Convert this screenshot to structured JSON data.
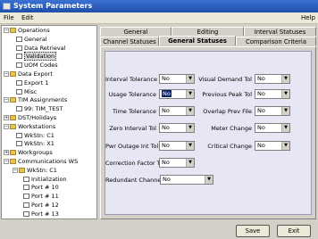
{
  "window": {
    "title": "System Parameters"
  },
  "menu": {
    "file": "File",
    "edit": "Edit",
    "help": "Help"
  },
  "tree": [
    {
      "label": "Operations",
      "type": "folder",
      "expander": "−"
    },
    {
      "label": "General",
      "type": "doc"
    },
    {
      "label": "Data Retrieval",
      "type": "doc"
    },
    {
      "label": "Validation",
      "type": "doc",
      "selected": true
    },
    {
      "label": "UOM Codes",
      "type": "doc"
    },
    {
      "label": "Data Export",
      "type": "folder",
      "expander": "−"
    },
    {
      "label": "Export 1",
      "type": "doc"
    },
    {
      "label": "Misc",
      "type": "doc"
    },
    {
      "label": "TIM Assignments",
      "type": "folder",
      "expander": "−"
    },
    {
      "label": "99: TIM_TEST",
      "type": "doc"
    },
    {
      "label": "DST/Holidays",
      "type": "folder",
      "expander": "+"
    },
    {
      "label": "Workstations",
      "type": "folder",
      "expander": "−"
    },
    {
      "label": "WkStn: C1",
      "type": "doc"
    },
    {
      "label": "WkStn: X1",
      "type": "doc"
    },
    {
      "label": "Workgroups",
      "type": "folder",
      "expander": "+"
    },
    {
      "label": "Communications WS",
      "type": "folder",
      "expander": "−"
    },
    {
      "label": "WkStn: C1",
      "type": "folder",
      "expander": "−"
    },
    {
      "label": "Initialization",
      "type": "doc"
    },
    {
      "label": "Port # 10",
      "type": "doc"
    },
    {
      "label": "Port # 11",
      "type": "doc"
    },
    {
      "label": "Port # 12",
      "type": "doc"
    },
    {
      "label": "Port # 13",
      "type": "doc"
    }
  ],
  "tabs_row1": [
    "General",
    "Editing",
    "Interval Statuses"
  ],
  "tabs_row2": [
    "Channel Statuses",
    "General Statuses",
    "Comparison Criteria"
  ],
  "active_tab": "General Statuses",
  "fields_left": [
    {
      "label": "Interval Tolerance",
      "value": "No"
    },
    {
      "label": "Usage Tolerance",
      "value": "No",
      "highlight": true
    },
    {
      "label": "Time Tolerance",
      "value": "No"
    },
    {
      "label": "Zero Interval Tol",
      "value": "No"
    },
    {
      "label": "Pwr Outage Int Tol",
      "value": "No"
    },
    {
      "label": "Correction Factor Tol",
      "value": "No"
    },
    {
      "label": "Redundant Channel",
      "value": "No"
    }
  ],
  "fields_right": [
    {
      "label": "Visual Demand Tol",
      "value": "No"
    },
    {
      "label": "Previous Peak Tol",
      "value": "No"
    },
    {
      "label": "Overlap Prev File",
      "value": "No"
    },
    {
      "label": "Meter Change",
      "value": "No"
    },
    {
      "label": "Critical Change",
      "value": "No"
    }
  ],
  "buttons": {
    "save": "Save",
    "exit": "Exit"
  }
}
